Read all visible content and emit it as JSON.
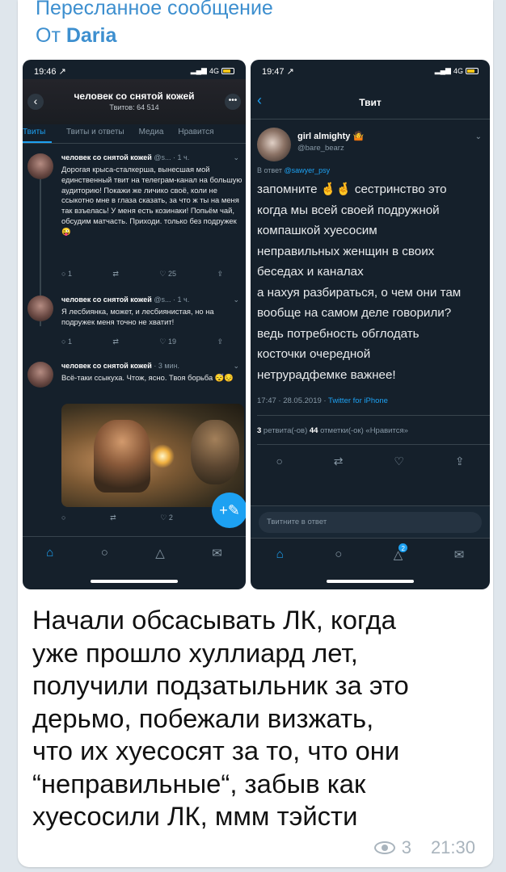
{
  "forward": {
    "title": "Пересланное сообщение",
    "from_prefix": "От ",
    "from_name": "Daria"
  },
  "left_screen": {
    "status_time": "19:46 ↗",
    "status_right": "4G",
    "profile_name": "человек со снятой кожей",
    "tweet_count": "Твитов: 64 514",
    "tabs": [
      "Твиты",
      "Твиты и ответы",
      "Медиа",
      "Нравится"
    ],
    "tweets": [
      {
        "author": "человек со снятой кожей",
        "meta": "@s... · 1 ч.",
        "text": "Дорогая крыса-сталкерша, вынесшая мой единственный твит на телеграм-канал на большую аудиторию! Покажи же личико своё, коли не ссыкотно мне в глаза сказать, за что ж ты на меня так взъелась! У меня есть козинаки! Попьём чай, обсудим матчасть. Приходи. только без подружек 😜",
        "actions": [
          "1",
          "",
          "25",
          ""
        ]
      },
      {
        "author": "человек со снятой кожей",
        "meta": "@s... · 1 ч.",
        "text": "Я лесбиянка, может, и лесбиянистая, но на подружек меня точно не хватит!",
        "actions": [
          "1",
          "",
          "19",
          ""
        ]
      },
      {
        "author": "человек со снятой кожей",
        "meta": "· 3 мин.",
        "text": "Всё-таки ссыкуха. Чтож, ясно. Твоя борьба 😴😔",
        "actions": [
          "",
          "",
          "2",
          ""
        ]
      }
    ],
    "fab_icon": "+✎",
    "tab_icons": [
      "home-icon",
      "search-icon",
      "bell-icon",
      "mail-icon"
    ]
  },
  "right_screen": {
    "status_time": "19:47 ↗",
    "status_right": "4G",
    "header_title": "Твит",
    "author_name": "girl almighty 🤷",
    "author_handle": "@bare_bearz",
    "reply_prefix": "В ответ ",
    "reply_handle": "@sawyer_psy",
    "text": "запомните 🤞🤞 сестринство это\nкогда мы всей своей подружной\nкомпашкой хуесосим\nнеправильных женщин в своих\nбеседах и каналах\nа нахуя разбираться, о чем они там\nвообще на самом деле говорили?\nведь потребность обглодать\nкосточки очередной\nнетрурадфемке важнее!",
    "date": "17:47 · 28.05.2019 · ",
    "client": "Twitter for iPhone",
    "retweets_num": "3",
    "retweets_label": " ретвита(-ов) ",
    "likes_num": "44",
    "likes_label": " отметки(-ок) «Нравится»",
    "compose_placeholder": "Твитните в ответ",
    "notif_badge": "2"
  },
  "caption": "Начали обсасывать ЛК, когда\nуже прошло хуллиард лет,\nполучили подзатыльник за это\nдерьмо, побежали визжать,\nчто их хуесосят за то, что они\n“неправильные“, забыв как\nхуесосили ЛК, ммм тэйсти",
  "views": "3",
  "time": "21:30",
  "colors": {
    "accent": "#3d8fcf",
    "twitter_blue": "#1da1f2",
    "dark_bg": "#15202b",
    "chat_bg": "#dfe6ec"
  }
}
